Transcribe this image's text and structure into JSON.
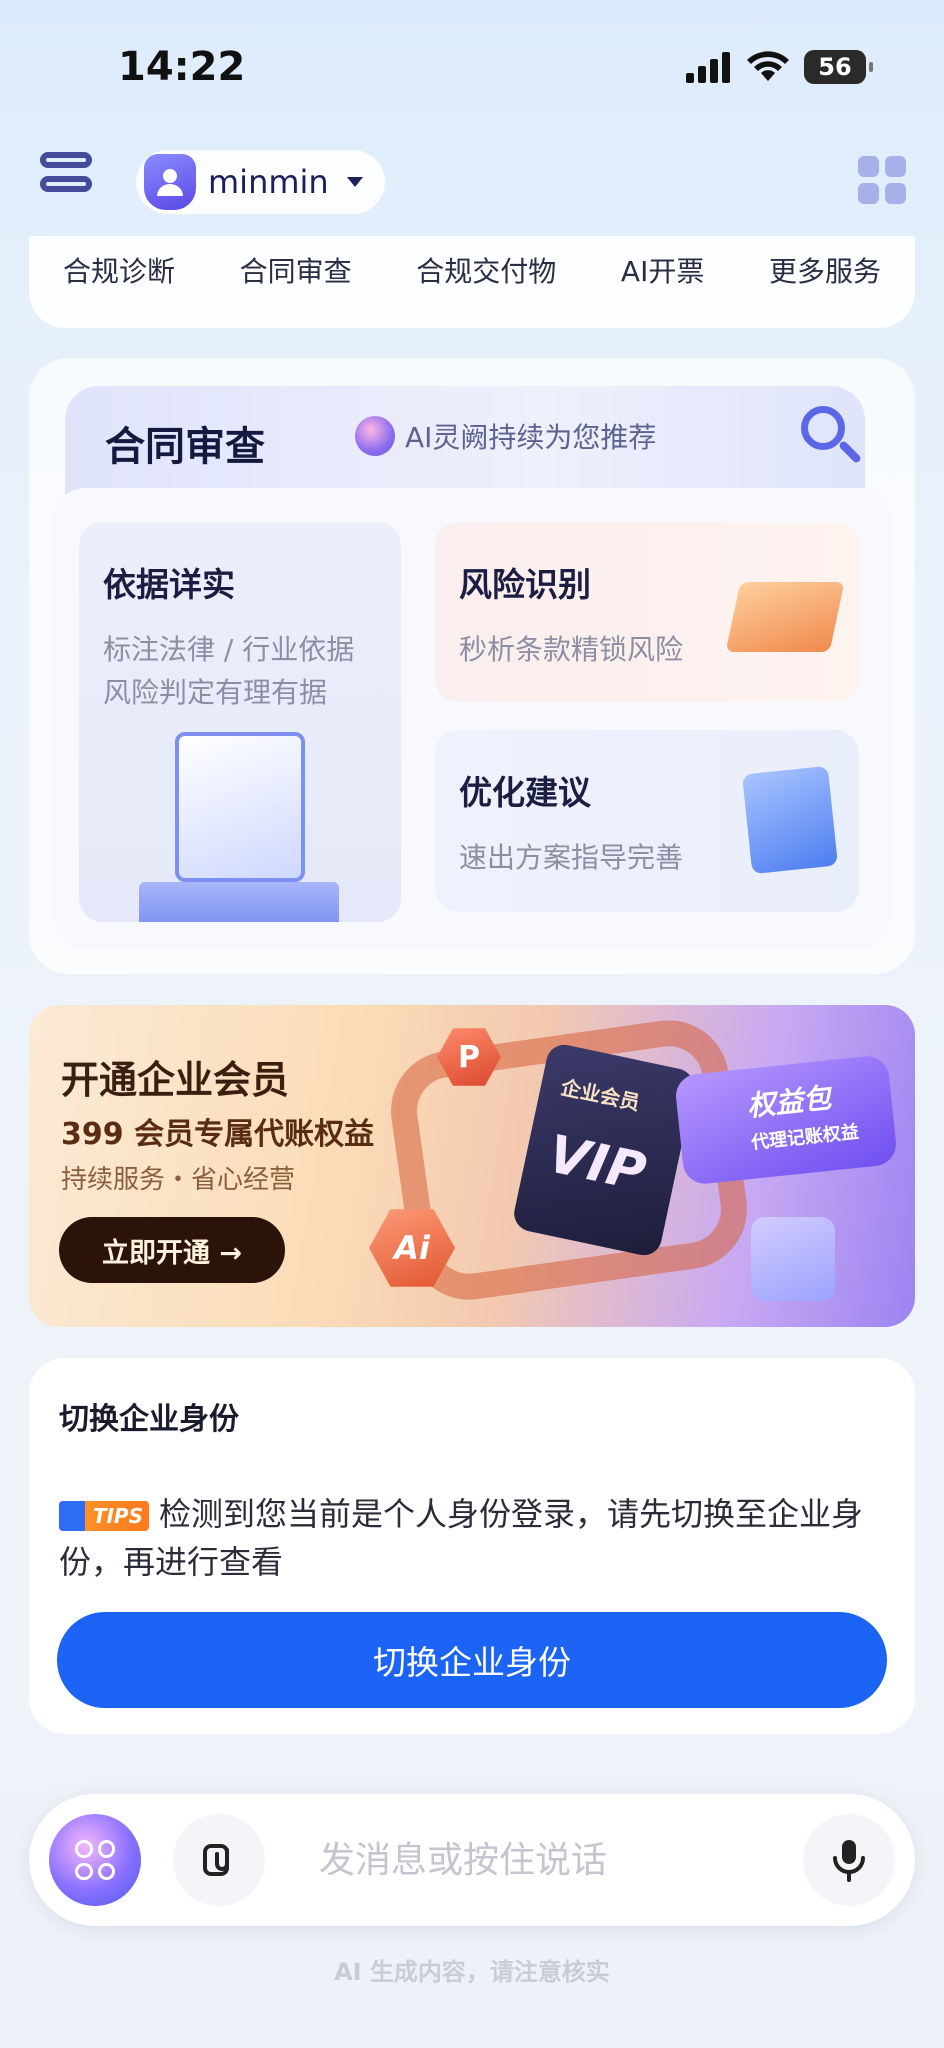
{
  "status_bar": {
    "time": "14:22",
    "battery": "56"
  },
  "header": {
    "username": "minmin"
  },
  "services": [
    "合规诊断",
    "合同审查",
    "合规交付物",
    "AI开票",
    "更多服务"
  ],
  "contract_review": {
    "title": "合同审查",
    "ai_tag": "AI灵阙持续为您推荐",
    "features": [
      {
        "title": "依据详实",
        "desc": [
          "标注法律 / 行业依据",
          "风险判定有理有据"
        ]
      },
      {
        "title": "风险识别",
        "desc": [
          "秒析条款精锁风险"
        ]
      },
      {
        "title": "优化建议",
        "desc": [
          "速出方案指导完善"
        ]
      }
    ]
  },
  "vip_banner": {
    "title": "开通企业会员",
    "subtitle": "399 会员专属代账权益",
    "desc": "持续服务・省心经营",
    "button": "立即开通 →",
    "card_label": "企业会员",
    "card_big": "VIP",
    "pack_title": "权益包",
    "pack_sub": "代理记账权益",
    "hex_ai": "Ai",
    "hex_p": "P"
  },
  "switch_identity": {
    "title": "切换企业身份",
    "tips_label": "TIPS",
    "message": "检测到您当前是个人身份登录，请先切换至企业身份，再进行查看",
    "button": "切换企业身份"
  },
  "input_bar": {
    "placeholder": "发消息或按住说话"
  },
  "disclaimer": "AI 生成内容，请注意核实",
  "colors": {
    "primary": "#1b64f5",
    "vip_button": "#2c130a",
    "accent_purple": "#5a47e6"
  }
}
